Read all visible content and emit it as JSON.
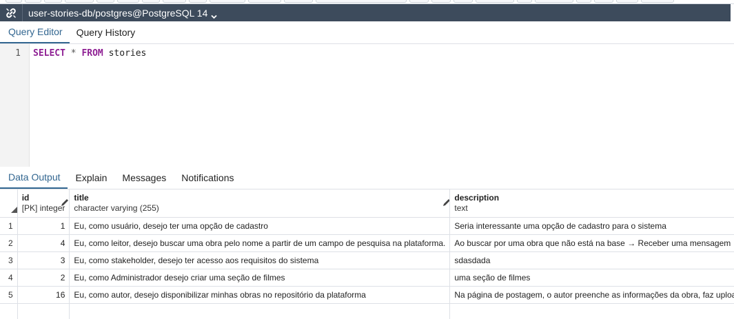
{
  "connection": {
    "label": "user-stories-db/postgres@PostgreSQL 14",
    "icon": "link-icon",
    "colors": {
      "bar": "#3d4b5c",
      "accent": "#326690"
    }
  },
  "editor_tabs": [
    {
      "label": "Query Editor",
      "active": true
    },
    {
      "label": "Query History",
      "active": false
    }
  ],
  "editor": {
    "line_number": "1",
    "tokens": [
      {
        "text": "SELECT",
        "kind": "kw"
      },
      {
        "text": " * ",
        "kind": "op"
      },
      {
        "text": "FROM",
        "kind": "kw"
      },
      {
        "text": " stories",
        "kind": "id"
      }
    ]
  },
  "output_tabs": [
    {
      "label": "Data Output",
      "active": true
    },
    {
      "label": "Explain",
      "active": false
    },
    {
      "label": "Messages",
      "active": false
    },
    {
      "label": "Notifications",
      "active": false
    }
  ],
  "grid": {
    "columns": [
      {
        "name": "id",
        "type": "[PK] integer",
        "editable": true
      },
      {
        "name": "title",
        "type": "character varying (255)",
        "editable": true
      },
      {
        "name": "description",
        "type": "text",
        "editable": false
      }
    ],
    "rows": [
      {
        "rownum": "1",
        "id": "1",
        "title": "Eu, como usuário, desejo ter uma opção de cadastro",
        "description": "Seria interessante uma opção de cadastro para o sistema"
      },
      {
        "rownum": "2",
        "id": "4",
        "title": "Eu, como leitor, desejo buscar uma obra pelo nome a partir de um campo de pesquisa na plataforma.",
        "description": "Ao buscar por uma obra que não está na base → Receber uma mensagem"
      },
      {
        "rownum": "3",
        "id": "3",
        "title": "Eu, como stakeholder, desejo ter acesso aos requisitos do sistema",
        "description": "sdasdada"
      },
      {
        "rownum": "4",
        "id": "2",
        "title": "Eu, como Administrador desejo criar uma seção de filmes",
        "description": "uma seção de filmes"
      },
      {
        "rownum": "5",
        "id": "16",
        "title": "Eu, como autor, desejo disponibilizar minhas obras no repositório da plataforma",
        "description": "Na página de postagem, o autor preenche as informações da obra, faz upload"
      }
    ]
  }
}
